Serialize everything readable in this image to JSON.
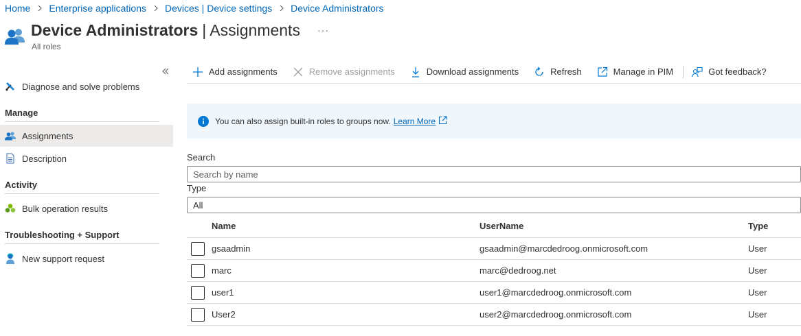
{
  "breadcrumb": {
    "items": [
      "Home",
      "Enterprise applications",
      "Devices | Device settings",
      "Device Administrators"
    ]
  },
  "header": {
    "title": "Device Administrators",
    "separator": "|",
    "subtitle_part": "Assignments",
    "more": "···",
    "caption": "All roles"
  },
  "sidebar": {
    "collapse_icon": "double-chevron-left-icon",
    "top_item": {
      "label": "Diagnose and solve problems",
      "icon": "wrench-icon"
    },
    "sections": [
      {
        "title": "Manage",
        "items": [
          {
            "label": "Assignments",
            "icon": "users-icon",
            "selected": true
          },
          {
            "label": "Description",
            "icon": "document-icon",
            "selected": false
          }
        ]
      },
      {
        "title": "Activity",
        "items": [
          {
            "label": "Bulk operation results",
            "icon": "clover-icon",
            "selected": false
          }
        ]
      },
      {
        "title": "Troubleshooting + Support",
        "items": [
          {
            "label": "New support request",
            "icon": "support-person-icon",
            "selected": false
          }
        ]
      }
    ]
  },
  "toolbar": {
    "add": "Add assignments",
    "remove": "Remove assignments",
    "download": "Download assignments",
    "refresh": "Refresh",
    "pim": "Manage in PIM",
    "feedback": "Got feedback?"
  },
  "banner": {
    "text": "You can also assign built-in roles to groups now.",
    "link": "Learn More"
  },
  "filters": {
    "search_label": "Search",
    "search_placeholder": "Search by name",
    "type_label": "Type",
    "type_value": "All"
  },
  "table": {
    "columns": [
      "Name",
      "UserName",
      "Type"
    ],
    "rows": [
      {
        "name": "gsaadmin",
        "username": "gsaadmin@marcdedroog.onmicrosoft.com",
        "type": "User"
      },
      {
        "name": "marc",
        "username": "marc@dedroog.net",
        "type": "User"
      },
      {
        "name": "user1",
        "username": "user1@marcdedroog.onmicrosoft.com",
        "type": "User"
      },
      {
        "name": "User2",
        "username": "user2@marcdedroog.onmicrosoft.com",
        "type": "User"
      }
    ]
  },
  "colors": {
    "link": "#0067b8",
    "selected_bg": "#edebe9",
    "banner_bg": "#eff6fc",
    "info_icon": "#0078d4",
    "disabled_text": "#a19f9d"
  }
}
